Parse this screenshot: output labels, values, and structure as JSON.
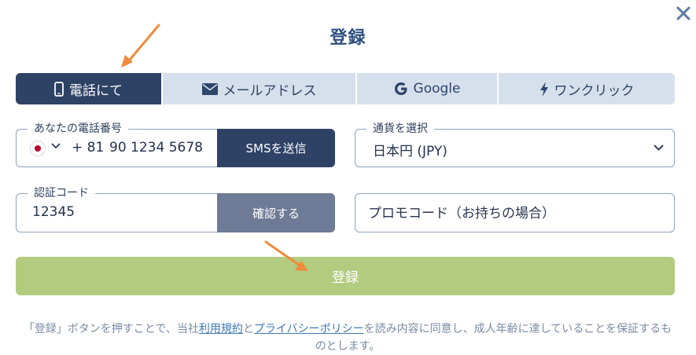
{
  "modal": {
    "title": "登録"
  },
  "close": {
    "icon": "close-icon"
  },
  "tabs": [
    {
      "label": "電話にて",
      "icon": "phone-icon",
      "active": true
    },
    {
      "label": "メールアドレス",
      "icon": "envelope-icon",
      "active": false
    },
    {
      "label": "Google",
      "icon": "google-icon",
      "active": false
    },
    {
      "label": "ワンクリック",
      "icon": "lightning-icon",
      "active": false
    }
  ],
  "phone": {
    "legend": "あなたの電話番号",
    "country_code": "+ 81",
    "number": "90 1234 5678",
    "sms_button": "SMSを送信",
    "flag_icon": "japan-flag-icon"
  },
  "currency": {
    "legend": "通貨を選択",
    "selected": "日本円 (JPY)"
  },
  "verification": {
    "legend": "認証コード",
    "value": "12345",
    "confirm_button": "確認する"
  },
  "promo": {
    "placeholder": "プロモコード（お持ちの場合）"
  },
  "register_button": "登録",
  "terms": {
    "prefix": "「登録」ボタンを押すことで、当社",
    "link1": "利用規約",
    "middle": "と",
    "link2": "プライバシーポリシー",
    "suffix": "を読み内容に同意し、成人年齢に達していることを保証するものとします。"
  },
  "colors": {
    "primary": "#2e4266",
    "tab_inactive": "#d6e0ec",
    "confirm_button": "#6e7b96",
    "register_button": "#b2cb7f",
    "link": "#3d79b8",
    "annotation_arrow": "#f08a3c",
    "title": "#2e5080"
  }
}
